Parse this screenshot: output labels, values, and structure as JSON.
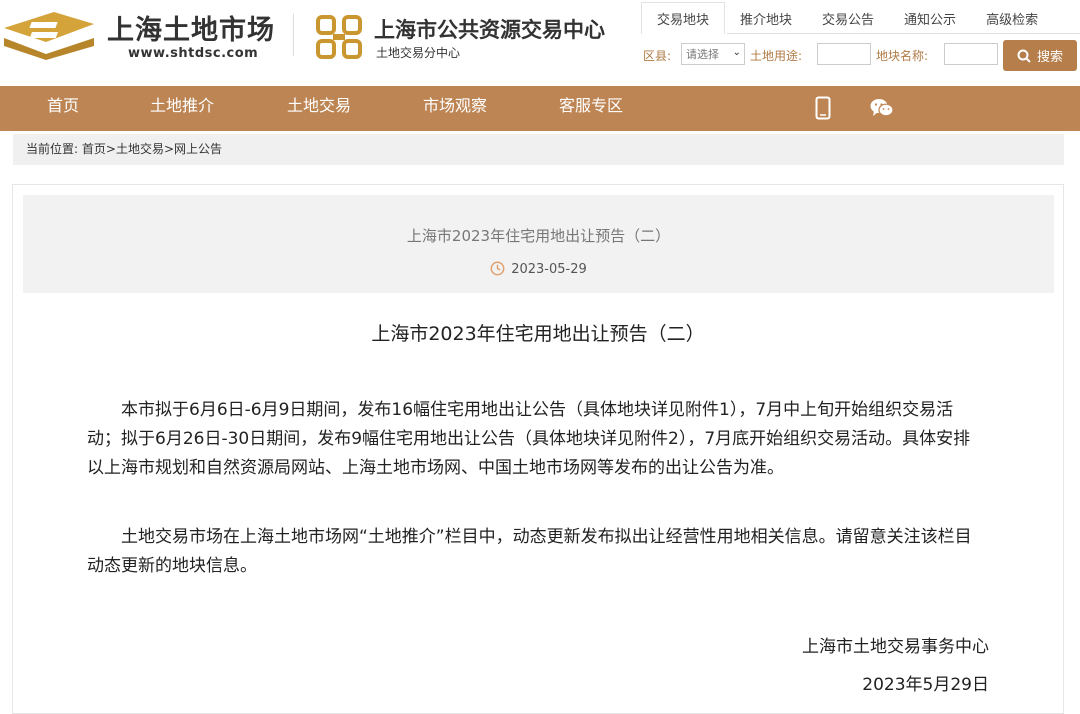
{
  "header": {
    "brand1_title": "上海土地市场",
    "brand1_url": "www.shtdsc.com",
    "brand2_title": "上海市公共资源交易中心",
    "brand2_sub": "土地交易分中心"
  },
  "tabs": [
    {
      "label": "交易地块",
      "active": true
    },
    {
      "label": "推介地块",
      "active": false
    },
    {
      "label": "交易公告",
      "active": false
    },
    {
      "label": "通知公示",
      "active": false
    },
    {
      "label": "高级检索",
      "active": false
    }
  ],
  "search": {
    "district_label": "区县:",
    "district_value": "请选择",
    "use_label": "土地用途:",
    "use_value": "",
    "name_label": "地块名称:",
    "name_value": "",
    "button_label": "搜索"
  },
  "nav": {
    "items": [
      "首页",
      "土地推介",
      "土地交易",
      "市场观察",
      "客服专区"
    ],
    "icons": [
      "mobile-icon",
      "wechat-icon"
    ]
  },
  "breadcrumb": {
    "prefix": "当前位置:",
    "items": [
      "首页",
      "土地交易",
      "网上公告"
    ],
    "sep": ">"
  },
  "article": {
    "header_title": "上海市2023年住宅用地出让预告（二）",
    "date": "2023-05-29",
    "title": "上海市2023年住宅用地出让预告（二）",
    "paragraphs": [
      "本市拟于6月6日-6月9日期间，发布16幅住宅用地出让公告（具体地块详见附件1），7月中上旬开始组织交易活动；拟于6月26日-30日期间，发布9幅住宅用地出让公告（具体地块详见附件2），7月底开始组织交易活动。具体安排以上海市规划和自然资源局网站、上海土地市场网、中国土地市场网等发布的出让公告为准。",
      "土地交易市场在上海土地市场网“土地推介”栏目中，动态更新发布拟出让经营性用地相关信息。请留意关注该栏目动态更新的地块信息。"
    ],
    "sign_org": "上海市土地交易事务中心",
    "sign_date": "2023年5月29日"
  },
  "colors": {
    "accent": "#bd8553",
    "accent_dark": "#b57e4b",
    "logo_gold": "#c9962f"
  }
}
